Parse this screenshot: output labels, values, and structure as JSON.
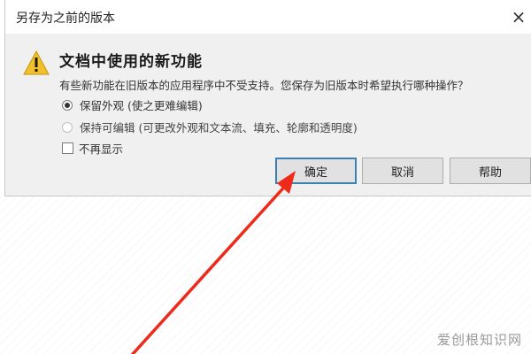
{
  "dialog": {
    "title": "另存为之前的版本",
    "close_glyph": "×",
    "heading": "文档中使用的新功能",
    "message": "有些新功能在旧版本的应用程序中不受支持。您保存为旧版本时希望执行哪种操作？",
    "options": [
      {
        "label": "保留外观 (使之更难编辑)",
        "checked": true
      },
      {
        "label": "保持可编辑 (可更改外观和文本流、填充、轮廓和透明度)",
        "checked": false
      }
    ],
    "checkbox_label": "不再显示",
    "checkbox_checked": false,
    "buttons": {
      "ok": "确定",
      "cancel": "取消",
      "help": "帮助"
    },
    "warning_icon": "warning-triangle-icon"
  },
  "annotation": {
    "arrow_color": "#ee2a1b"
  },
  "watermark": "爱创根知识网"
}
